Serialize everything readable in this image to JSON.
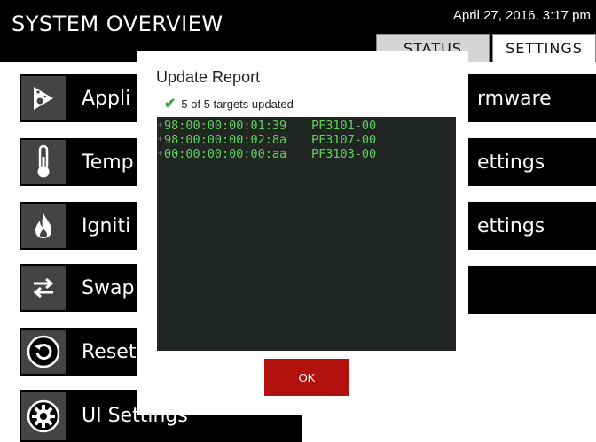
{
  "header": {
    "title": "SYSTEM OVERVIEW",
    "datetime": "April 27, 2016, 3:17 pm",
    "tabs": [
      {
        "label": "STATUS",
        "active": false
      },
      {
        "label": "SETTINGS",
        "active": true
      }
    ]
  },
  "menu": {
    "left_items": [
      {
        "label": "Appli",
        "icon": "wizard-icon"
      },
      {
        "label": "Temp",
        "icon": "thermometer-icon"
      },
      {
        "label": "Igniti",
        "icon": "flame-icon"
      },
      {
        "label": "Swap",
        "icon": "swap-arrows-icon"
      },
      {
        "label": "Reset",
        "icon": "reset-icon"
      },
      {
        "label": "UI Settings",
        "icon": "gear-icon"
      }
    ],
    "right_items": [
      {
        "label": "rmware"
      },
      {
        "label": "ettings"
      },
      {
        "label": "ettings"
      },
      {
        "label": ""
      }
    ]
  },
  "dialog": {
    "title": "Update Report",
    "status": "5 of 5 targets updated",
    "rows": [
      {
        "address": "98:00:00:00:01:39",
        "model": "PF3101-00"
      },
      {
        "address": "98:00:00:00:02:8a",
        "model": "PF3107-00"
      },
      {
        "address": "00:00:00:00:00:aa",
        "model": "PF3103-00"
      }
    ],
    "ok_label": "OK"
  },
  "colors": {
    "header_bg": "#000000",
    "icon_bg": "#444444",
    "console_bg": "#222622",
    "console_text": "#5fd35f",
    "ok_button": "#b3110d",
    "check": "#35a832"
  }
}
